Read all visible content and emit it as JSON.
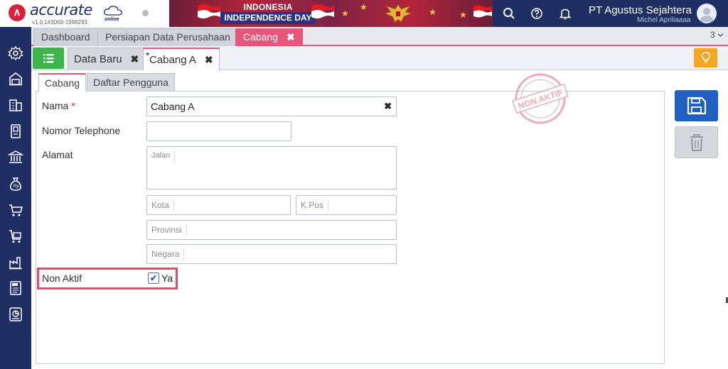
{
  "app": {
    "logo_text": "accurate",
    "logo_sub": "online",
    "version": "v1.0.1#3068-1998293"
  },
  "banner": {
    "line1": "INDONESIA",
    "line2": "INDEPENDENCE DAY"
  },
  "header": {
    "company": "PT Agustus Sejahtera",
    "user": "Michel Apriliaaaa",
    "icons": [
      "search-icon",
      "help-icon",
      "bell-icon",
      "avatar"
    ]
  },
  "sidebar": {
    "icons": [
      "settings-icon",
      "warehouse-icon",
      "building-icon",
      "ledger-icon",
      "bank-icon",
      "money-bag-icon",
      "cart-icon",
      "cart-box-icon",
      "factory-icon",
      "tax-icon",
      "report-icon"
    ]
  },
  "main_tabs": [
    {
      "label": "Dashboard"
    },
    {
      "label": "Persiapan Data Perusahaan"
    },
    {
      "label": "Cabang",
      "close": "✖"
    }
  ],
  "tab_count": "3",
  "sub_tabs": [
    {
      "label": "Data Baru",
      "close": "✖"
    },
    {
      "label": "Cabang A",
      "close": "✖",
      "modified": "*"
    }
  ],
  "form_tabs": [
    "Cabang",
    "Daftar Pengguna"
  ],
  "form": {
    "nama_label": "Nama",
    "nama_required": "*",
    "nama_value": "Cabang A",
    "nama_clear": "✖",
    "telepon_label": "Nomor Telephone",
    "telepon_value": "",
    "alamat_label": "Alamat",
    "jalan_ph": "Jalan",
    "kota_ph": "Kota",
    "kpos_ph": "K.Pos",
    "provinsi_ph": "Provinsi",
    "negara_ph": "Negara",
    "nonaktif_label": "Non Aktif",
    "nonaktif_checked": true,
    "nonaktif_check": "✔",
    "nonaktif_option": "Ya"
  },
  "stamp_text": "NON AKTIF",
  "colors": {
    "nav": "#1f2f63",
    "accent_tab": "#e8557a",
    "save": "#1f5fbf",
    "list_button": "#3cb54a",
    "hint_button": "#f5a623",
    "highlight": "#e84a5f"
  }
}
